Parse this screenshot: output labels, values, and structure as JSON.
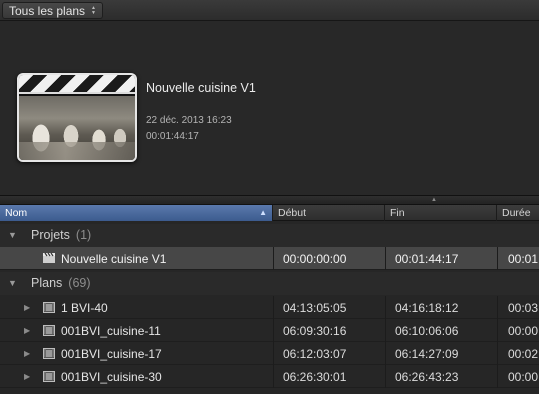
{
  "filter": {
    "label": "Tous les plans"
  },
  "project_preview": {
    "title": "Nouvelle cuisine V1",
    "date": "22 déc. 2013 16:23",
    "duration": "00:01:44:17"
  },
  "columns": {
    "name": "Nom",
    "start": "Début",
    "end": "Fin",
    "duration": "Durée"
  },
  "groups": {
    "projects": {
      "label": "Projets",
      "count": "(1)"
    },
    "clips": {
      "label": "Plans",
      "count": "(69)"
    }
  },
  "project_rows": [
    {
      "name": "Nouvelle cuisine V1",
      "start": "00:00:00:00",
      "end": "00:01:44:17",
      "duration": "00:01"
    }
  ],
  "clip_rows": [
    {
      "name": "1 BVI-40",
      "start": "04:13:05:05",
      "end": "04:16:18:12",
      "duration": "00:03"
    },
    {
      "name": "001BVI_cuisine-11",
      "start": "06:09:30:16",
      "end": "06:10:06:06",
      "duration": "00:00"
    },
    {
      "name": "001BVI_cuisine-17",
      "start": "06:12:03:07",
      "end": "06:14:27:09",
      "duration": "00:02"
    },
    {
      "name": "001BVI_cuisine-30",
      "start": "06:26:30:01",
      "end": "06:26:43:23",
      "duration": "00:00"
    }
  ],
  "icons": {
    "clapper": "clapperboard-icon",
    "clip": "film-strip-icon",
    "expanded": "triangle-down-icon",
    "collapsed": "triangle-right-icon",
    "sort": "sort-ascending-icon"
  },
  "colors": {
    "selection_header": "#4a6aa0",
    "background": "#262626",
    "selected_row": "#474747"
  }
}
